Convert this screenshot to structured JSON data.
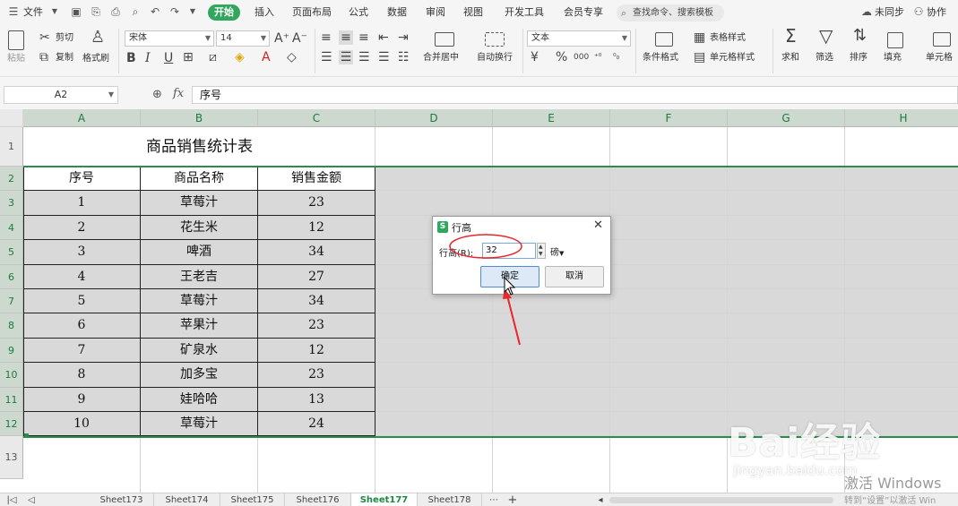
{
  "menubar": {
    "file": "文件",
    "tabs": [
      "开始",
      "插入",
      "页面布局",
      "公式",
      "数据",
      "审阅",
      "视图",
      "开发工具",
      "会员专享"
    ],
    "search": "查找命令、搜索模板",
    "unsynced": "未同步",
    "collab": "协作"
  },
  "ribbon": {
    "paste": "粘贴",
    "cut": "剪切",
    "copy": "复制",
    "format_painter": "格式刷",
    "font_name": "宋体",
    "font_size": "14",
    "merge_center": "合并居中",
    "wrap_text": "自动换行",
    "number_format": "文本",
    "conditional_format": "条件格式",
    "table_style": "表格样式",
    "cell_style": "单元格样式",
    "sum": "求和",
    "filter": "筛选",
    "sort": "排序",
    "fill": "填充",
    "cell": "单元格"
  },
  "formula_bar": {
    "name_box": "A2",
    "fx": "fx",
    "formula": "序号"
  },
  "columns": [
    "A",
    "B",
    "C",
    "D",
    "E",
    "F",
    "G",
    "H"
  ],
  "rows": [
    "1",
    "2",
    "3",
    "4",
    "5",
    "6",
    "7",
    "8",
    "9",
    "10",
    "11",
    "12",
    "13"
  ],
  "sheet": {
    "title": "商品销售统计表",
    "headers": [
      "序号",
      "商品名称",
      "销售金额"
    ],
    "data": [
      [
        "1",
        "草莓汁",
        "23"
      ],
      [
        "2",
        "花生米",
        "12"
      ],
      [
        "3",
        "啤酒",
        "34"
      ],
      [
        "4",
        "王老吉",
        "27"
      ],
      [
        "5",
        "草莓汁",
        "34"
      ],
      [
        "6",
        "苹果汁",
        "23"
      ],
      [
        "7",
        "矿泉水",
        "12"
      ],
      [
        "8",
        "加多宝",
        "23"
      ],
      [
        "9",
        "娃哈哈",
        "13"
      ],
      [
        "10",
        "草莓汁",
        "24"
      ]
    ]
  },
  "dialog": {
    "title": "行高",
    "label": "行高(R):",
    "value": "32",
    "unit": "磅",
    "ok": "确定",
    "cancel": "取消"
  },
  "sheet_tabs": [
    "Sheet173",
    "Sheet174",
    "Sheet175",
    "Sheet176",
    "Sheet177",
    "Sheet178"
  ],
  "active_sheet": "Sheet177",
  "watermark": {
    "logo": "Bai经验",
    "url": "jingyan.baidu.com"
  },
  "activation": {
    "line1": "激活 Windows",
    "line2": "转到“设置”以激活 Win"
  },
  "colors": {
    "accent": "#30a75c",
    "annotation": "#e8262c"
  }
}
